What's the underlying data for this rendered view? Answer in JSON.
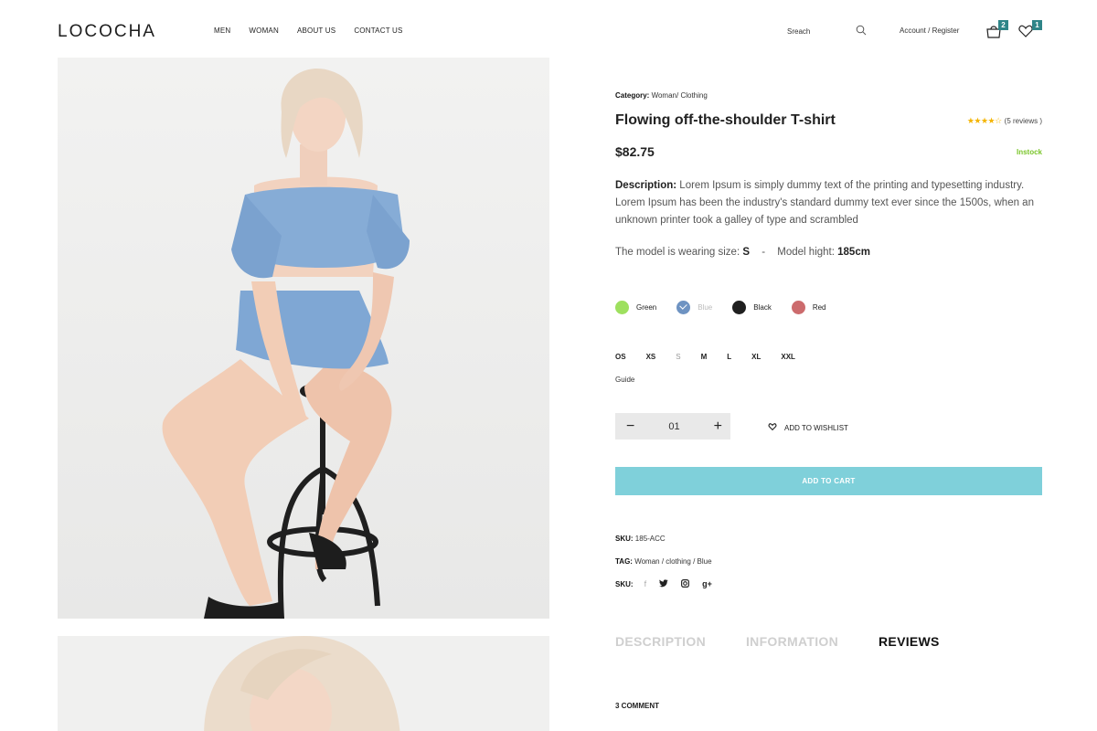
{
  "brand": {
    "logo": "LOCOCHA"
  },
  "nav": {
    "items": [
      "MEN",
      "WOMAN",
      "ABOUT US",
      "CONTACT US"
    ]
  },
  "search": {
    "placeholder": "Sreach"
  },
  "account": {
    "label": "Account / Register"
  },
  "cart": {
    "count": "2"
  },
  "wishlist_header": {
    "count": "1"
  },
  "product": {
    "category_label": "Category:",
    "category_value": "Woman/ Clothing",
    "title": "Flowing off-the-shoulder T-shirt",
    "rating": {
      "stars": "★★★★☆",
      "reviews": "(5 reviews )",
      "value": 4,
      "max": 5
    },
    "price": "$82.75",
    "stock": "Instock",
    "description_label": "Description:",
    "description": "Lorem Ipsum is simply dummy text of the printing and typesetting industry. Lorem Ipsum has been the industry's standard dummy text ever since the 1500s, when an unknown printer took a galley of type and scrambled",
    "model_size_label": "The model is wearing size:",
    "model_size": "S",
    "model_sep": "-",
    "model_height_label": "Model hight:",
    "model_height": "185cm",
    "colors": [
      {
        "name": "Green",
        "hex": "#9ee05f",
        "selected": false
      },
      {
        "name": "Blue",
        "hex": "#6e93c2",
        "selected": true
      },
      {
        "name": "Black",
        "hex": "#1f1f1f",
        "selected": false
      },
      {
        "name": "Red",
        "hex": "#cc6b6d",
        "selected": false
      }
    ],
    "sizes": [
      "OS",
      "XS",
      "S",
      "M",
      "L",
      "XL",
      "XXL"
    ],
    "guide": "Guide",
    "quantity": {
      "minus": "−",
      "value": "01",
      "plus": "+"
    },
    "wishlist_label": "ADD TO WISHLIST",
    "add_to_cart": "ADD TO CART",
    "sku_label": "SKU:",
    "sku_value": "185-ACC",
    "tag_label": "TAG:",
    "tag_value": "Woman / clothing / Blue",
    "share_label": "SKU:",
    "socials": [
      {
        "icon": "facebook-icon",
        "glyph": "f"
      },
      {
        "icon": "twitter-icon",
        "glyph": "t"
      },
      {
        "icon": "instagram-icon",
        "glyph": "◘"
      },
      {
        "icon": "google-plus-icon",
        "glyph": "g+"
      }
    ]
  },
  "tabs": [
    "DESCRIPTION",
    "INFORMATION",
    "REVIEWS"
  ],
  "comments": {
    "label": "3 COMMENT"
  },
  "colors": {
    "accent": "#7fd0da",
    "badge": "#2f8588",
    "instock": "#7ac52a",
    "stars": "#f4b400"
  }
}
